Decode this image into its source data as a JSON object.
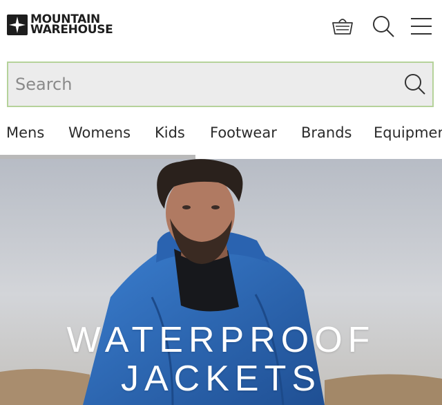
{
  "brand": {
    "line1": "MOUNTAIN",
    "line2": "WAREHOUSE",
    "icon": "compass-star-logo"
  },
  "header": {
    "basket_icon": "basket-icon",
    "search_icon": "search-icon",
    "menu_icon": "hamburger-menu-icon"
  },
  "search": {
    "placeholder": "Search",
    "value": "",
    "border_color": "#b5d29a",
    "background": "#ececec"
  },
  "nav": {
    "items": [
      {
        "label": "Mens"
      },
      {
        "label": "Womens"
      },
      {
        "label": "Kids"
      },
      {
        "label": "Footwear"
      },
      {
        "label": "Brands"
      },
      {
        "label": "Equipmen"
      }
    ]
  },
  "hero": {
    "line1": "WATERPROOF",
    "line2": "JACKETS",
    "jacket_color": "#2f6fc4"
  }
}
